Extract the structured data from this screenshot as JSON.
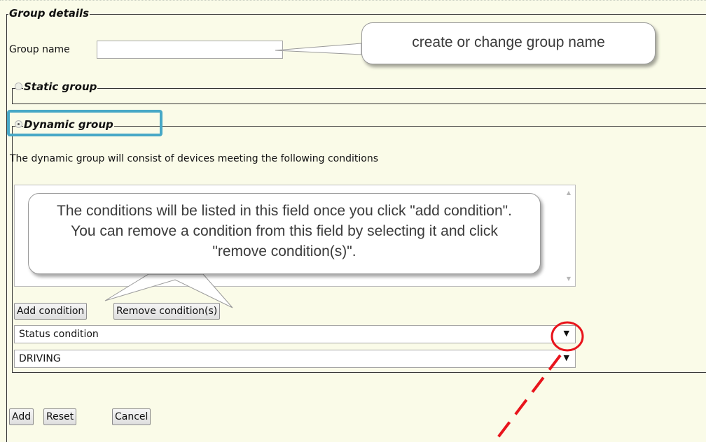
{
  "group_details": {
    "legend": "Group details",
    "group_name_label": "Group name",
    "group_name_value": ""
  },
  "static_group": {
    "legend": "Static group",
    "selected": false
  },
  "dynamic_group": {
    "legend": "Dynamic group",
    "selected": true,
    "description": "The dynamic group will consist of devices meeting the following conditions",
    "add_condition_label": "Add condition",
    "remove_condition_label": "Remove condition(s)",
    "condition_type_select": "Status condition",
    "condition_value_select": "DRIVING"
  },
  "footer": {
    "add_label": "Add",
    "reset_label": "Reset",
    "cancel_label": "Cancel"
  },
  "annotations": {
    "callout_group_name": "create or change group name",
    "callout_conditions": "The conditions will be listed in this field once you click \"add condition\". You can remove a condition from this field by selecting it and click \"remove condition(s)\".",
    "highlight_color": "#47a8c6",
    "marker_color": "#e8141c"
  }
}
